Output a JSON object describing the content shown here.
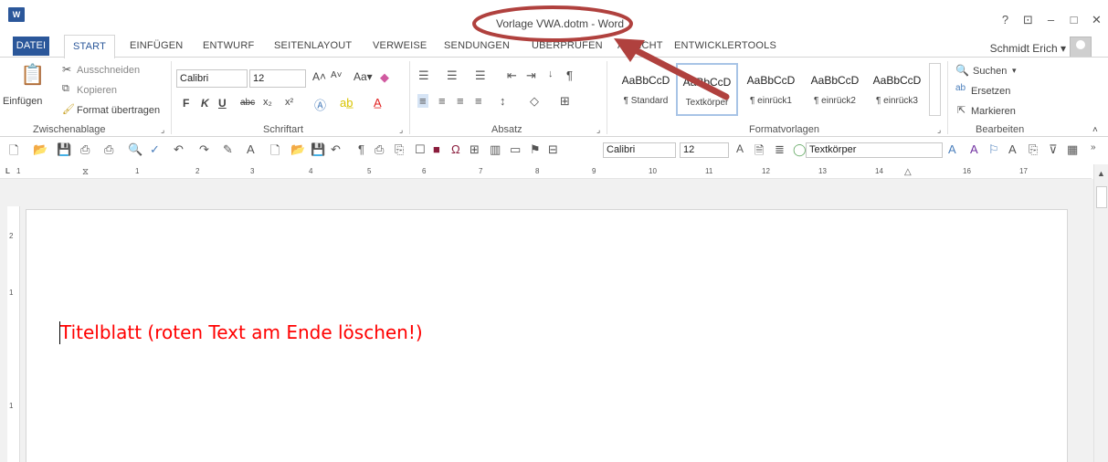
{
  "window": {
    "title": "Vorlage VWA.dotm - Word",
    "app_icon": "word-icon",
    "controls": [
      "?",
      "⊡",
      "–",
      "□",
      "✕"
    ]
  },
  "tabs": [
    "DATEI",
    "START",
    "EINFÜGEN",
    "ENTWURF",
    "SEITENLAYOUT",
    "VERWEISE",
    "SENDUNGEN",
    "ÜBERPRÜFEN",
    "ANSICHT",
    "ENTWICKLERTOOLS"
  ],
  "active_tab": "START",
  "user": {
    "name": "Schmidt Erich ▾"
  },
  "clipboard": {
    "paste": "Einfügen",
    "cut": "Ausschneiden",
    "copy": "Kopieren",
    "format_painter": "Format übertragen",
    "group_label": "Zwischenablage"
  },
  "font": {
    "name": "Calibri",
    "size": "12",
    "group_label": "Schriftart",
    "bold": "F",
    "italic": "K",
    "underline": "U",
    "strikethrough": "abc",
    "subscript": "x₂",
    "superscript": "x²",
    "grow": "A˄",
    "shrink": "A˅",
    "case": "Aa▾"
  },
  "paragraph": {
    "group_label": "Absatz",
    "show_marks": "¶"
  },
  "styles": {
    "group_label": "Formatvorlagen",
    "items": [
      {
        "preview": "AaBbCcD",
        "name": "¶ Standard"
      },
      {
        "preview": "AaBbCcD",
        "name": "Textkörper"
      },
      {
        "preview": "AaBbCcD",
        "name": "¶ einrück1"
      },
      {
        "preview": "AaBbCcD",
        "name": "¶ einrück2"
      },
      {
        "preview": "AaBbCcD",
        "name": "¶ einrück3"
      }
    ]
  },
  "editing": {
    "find": "Suchen",
    "replace": "Ersetzen",
    "select": "Markieren",
    "group_label": "Bearbeiten"
  },
  "qat": {
    "font": "Calibri",
    "size": "12",
    "style": "Textkörper"
  },
  "ruler": {
    "numbers": [
      "1",
      "1",
      "2",
      "3",
      "4",
      "5",
      "6",
      "7",
      "8",
      "9",
      "10",
      "11",
      "12",
      "13",
      "14",
      "16",
      "17"
    ]
  },
  "vruler": {
    "numbers": [
      "2",
      "1",
      "1"
    ]
  },
  "document": {
    "text": "Titelblatt (roten Text am Ende löschen!)",
    "text_color": "#ff0000"
  },
  "colors": {
    "accent": "#2b579a",
    "annotation": "#b0413e"
  }
}
